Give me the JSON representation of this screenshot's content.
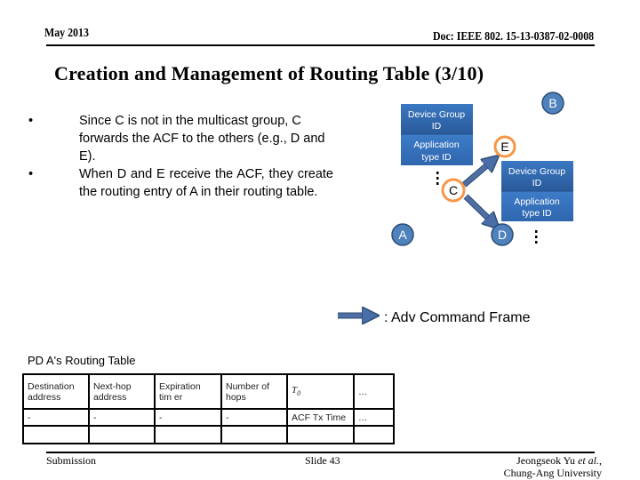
{
  "header": {
    "date": "May 2013",
    "doc_id": "Doc: IEEE 802. 15-13-0387-02-0008"
  },
  "slide_title": "Creation and Management of Routing Table (3/10)",
  "bullets": [
    {
      "marker": "•",
      "text": "Since C is not in the multicast group, C forwards the ACF to the others (e.g., D and E)."
    },
    {
      "marker": "•",
      "text": "When D and E receive the ACF, they create the routing entry of A in their routing table."
    }
  ],
  "diagram": {
    "nodes": {
      "A": "A",
      "B": "B",
      "C": "C",
      "D": "D",
      "E": "E"
    },
    "box_left": {
      "top_line1": "Device Group",
      "top_line2": "ID",
      "bottom_line1": "Application",
      "bottom_line2": "type  ID"
    },
    "box_right": {
      "top_line1": "Device Group",
      "top_line2": "ID",
      "bottom_line1": "Application",
      "bottom_line2": "type  ID"
    },
    "colors": {
      "node_fill": "#4f81bd",
      "node_stroke": "#2c4d75",
      "highlight_ring": "#f79646",
      "box_top": "#2e63a8",
      "box_bottom": "#3b78c3",
      "arrow": "#4f6fa3"
    }
  },
  "legend": {
    "label": ": Adv Command Frame"
  },
  "routing_table": {
    "caption": "PD A's Routing Table",
    "headers": [
      "Destination address",
      "Next-hop address",
      "Expiration tim er",
      "Number of hops",
      "T0",
      "…"
    ],
    "header_lines": [
      [
        "Destination",
        "address"
      ],
      [
        "Next-hop",
        "address"
      ],
      [
        "Expiration",
        "tim er"
      ],
      [
        "Number of",
        "hops"
      ],
      [
        "T",
        "0"
      ],
      [
        "…",
        ""
      ]
    ],
    "rows": [
      [
        "-",
        "-",
        "-",
        "-",
        "ACF Tx Time",
        "…"
      ],
      [
        "",
        "",
        "",
        "",
        "",
        ""
      ]
    ]
  },
  "footer": {
    "left": "Submission",
    "center": "Slide 43",
    "right_line1_name": "Jeongseok Yu ",
    "right_line1_etal": "et al.",
    "right_line1_comma": ",",
    "right_line2": "Chung-Ang University"
  }
}
